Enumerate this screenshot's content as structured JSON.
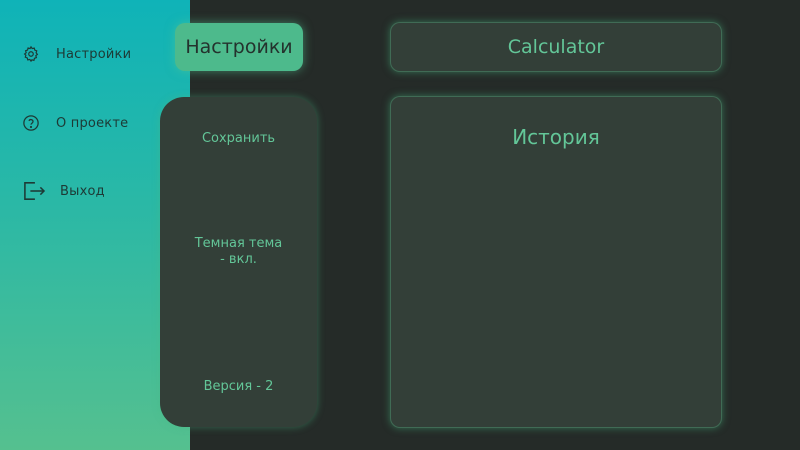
{
  "sidebar": {
    "items": [
      {
        "label": "Настройки",
        "icon": "gear-icon"
      },
      {
        "label": "О проекте",
        "icon": "help-circle-icon"
      },
      {
        "label": "Выход",
        "icon": "logout-icon"
      }
    ]
  },
  "header": {
    "settings_button": "Настройки",
    "app_title": "Calculator"
  },
  "settings_panel": {
    "save_label": "Сохранить",
    "theme_line1": "Темная тема",
    "theme_line2": "- вкл.",
    "version_label": "Версия - 2"
  },
  "history": {
    "title": "История"
  },
  "colors": {
    "sidebar_top": "#0fb3b8",
    "sidebar_bottom": "#55c08f",
    "background": "#252b28",
    "panel": "#333f38",
    "accent_text": "#63c698",
    "active_button": "#4dba8c"
  }
}
